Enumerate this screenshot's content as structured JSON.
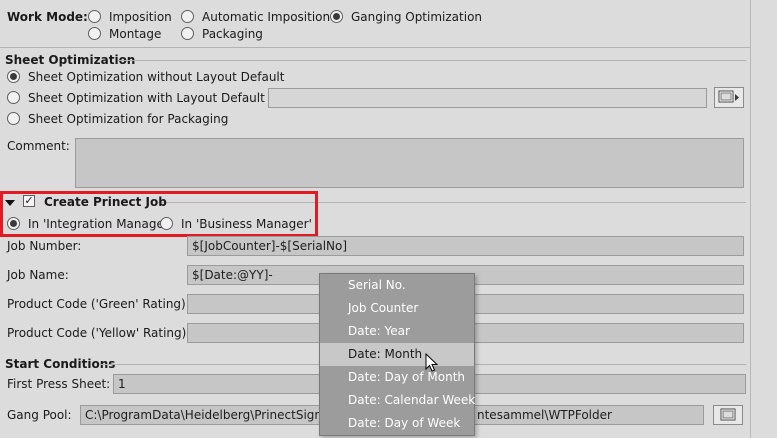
{
  "work_mode": {
    "label": "Work Mode:",
    "options": [
      {
        "label": "Imposition",
        "selected": false
      },
      {
        "label": "Automatic Imposition",
        "selected": false
      },
      {
        "label": "Ganging Optimization",
        "selected": true
      },
      {
        "label": "Montage",
        "selected": false
      },
      {
        "label": "Packaging",
        "selected": false
      }
    ]
  },
  "sheet_optimization": {
    "title": "Sheet Optimization",
    "options": [
      {
        "label": "Sheet Optimization without Layout Default",
        "selected": true
      },
      {
        "label": "Sheet Optimization with Layout Default",
        "selected": false
      },
      {
        "label": "Sheet Optimization for Packaging",
        "selected": false
      }
    ],
    "layout_default_value": ""
  },
  "comment": {
    "label": "Comment:",
    "value": ""
  },
  "create_job": {
    "label": "Create Prinect Job",
    "checked": true,
    "options": [
      {
        "label": "In 'Integration Manager'",
        "selected": true
      },
      {
        "label": "In 'Business Manager'",
        "selected": false
      }
    ]
  },
  "job_fields": {
    "job_number_label": "Job Number:",
    "job_number_value": "$[JobCounter]-$[SerialNo]",
    "job_name_label": "Job Name:",
    "job_name_value": "$[Date:@YY]-",
    "green_label": "Product Code ('Green' Rating):",
    "green_value": "",
    "yellow_label": "Product Code ('Yellow' Rating):",
    "yellow_value": ""
  },
  "start_conditions": {
    "title": "Start Conditions",
    "first_press_label": "First Press Sheet:",
    "first_press_value": "1",
    "gang_pool_label": "Gang Pool:",
    "gang_pool_value_left": "C:\\ProgramData\\Heidelberg\\PrinectSignaSt",
    "gang_pool_value_right": "ntesammel\\WTPFolder"
  },
  "context_menu": {
    "items": [
      {
        "label": "Serial No.",
        "highlighted": false
      },
      {
        "label": "Job Counter",
        "highlighted": false
      },
      {
        "label": "Date: Year",
        "highlighted": false
      },
      {
        "label": "Date: Month",
        "highlighted": true
      },
      {
        "label": "Date: Day of Month",
        "highlighted": false
      },
      {
        "label": "Date: Calendar Week",
        "highlighted": false
      },
      {
        "label": "Date: Day of Week",
        "highlighted": false
      }
    ]
  },
  "icons": {
    "browse": "folder-browse-icon",
    "cursor": "mouse-pointer-icon"
  },
  "colors": {
    "highlight_border": "#e01b24",
    "menu_bg": "#9c9c9c",
    "menu_highlight": "#c8c8c8"
  }
}
